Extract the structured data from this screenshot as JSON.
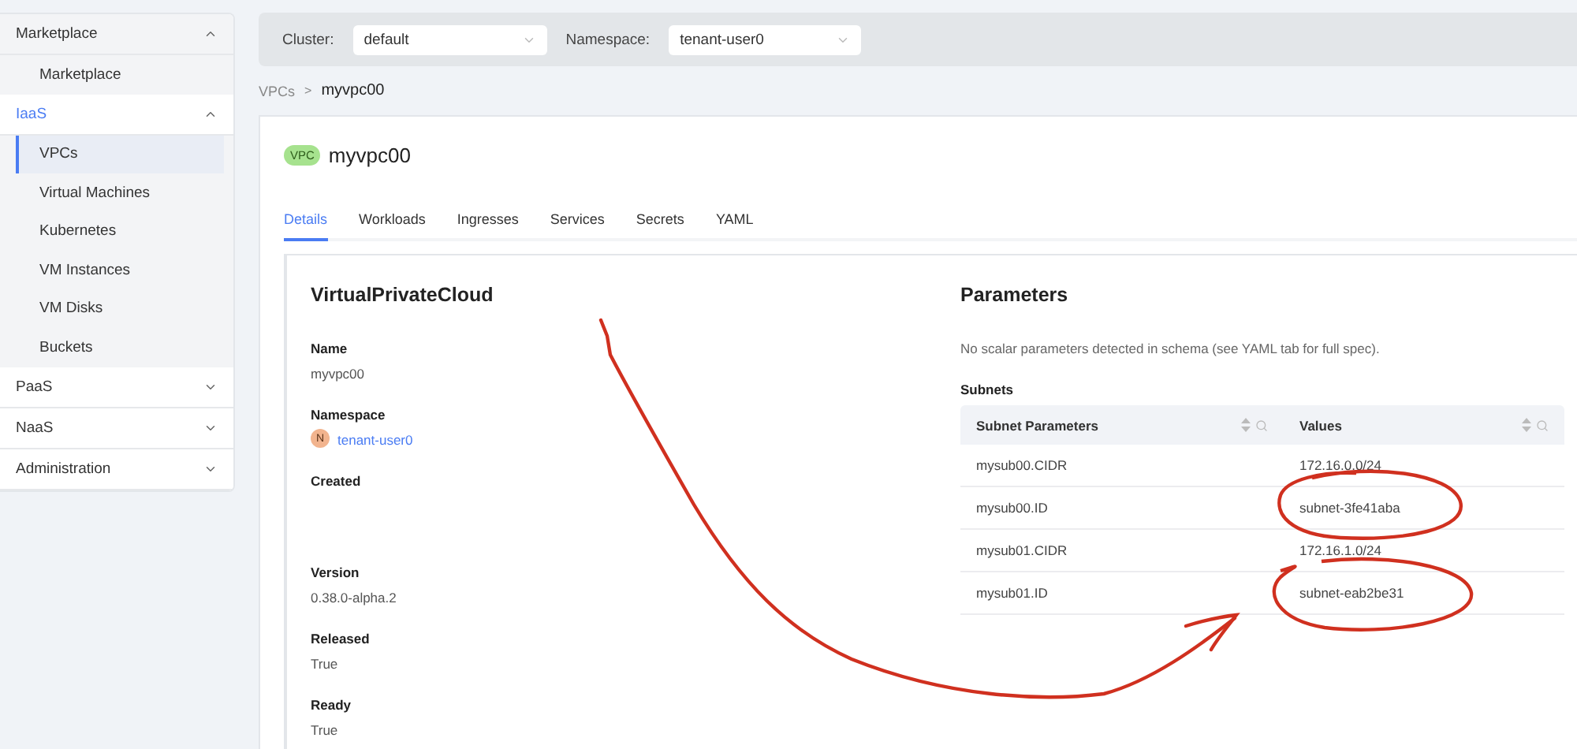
{
  "sidebar": {
    "groups": [
      {
        "label": "Marketplace",
        "expanded": true,
        "selected": false,
        "items": [
          {
            "label": "Marketplace",
            "selected": false
          }
        ]
      },
      {
        "label": "IaaS",
        "expanded": true,
        "selected": true,
        "items": [
          {
            "label": "VPCs",
            "selected": true
          },
          {
            "label": "Virtual Machines",
            "selected": false
          },
          {
            "label": "Kubernetes",
            "selected": false
          },
          {
            "label": "VM Instances",
            "selected": false
          },
          {
            "label": "VM Disks",
            "selected": false
          },
          {
            "label": "Buckets",
            "selected": false
          }
        ]
      },
      {
        "label": "PaaS",
        "expanded": false,
        "selected": false
      },
      {
        "label": "NaaS",
        "expanded": false,
        "selected": false
      },
      {
        "label": "Administration",
        "expanded": false,
        "selected": false
      }
    ]
  },
  "toolbar": {
    "cluster": {
      "label": "Cluster:",
      "value": "default"
    },
    "namespace": {
      "label": "Namespace:",
      "value": "tenant-user0"
    }
  },
  "breadcrumb": {
    "items": [
      "VPCs",
      "myvpc00"
    ],
    "separator": ">"
  },
  "header": {
    "badge": "VPC",
    "title": "myvpc00"
  },
  "tabs": [
    {
      "label": "Details",
      "selected": true
    },
    {
      "label": "Workloads",
      "selected": false
    },
    {
      "label": "Ingresses",
      "selected": false
    },
    {
      "label": "Services",
      "selected": false
    },
    {
      "label": "Secrets",
      "selected": false
    },
    {
      "label": "YAML",
      "selected": false
    }
  ],
  "details": {
    "title": "VirtualPrivateCloud",
    "fields": [
      {
        "kind": "text",
        "label": "Name",
        "value": "myvpc00"
      },
      {
        "kind": "namespace",
        "label": "Namespace",
        "avatar": "N",
        "value": "tenant-user0"
      },
      {
        "kind": "empty",
        "label": "Created"
      },
      {
        "kind": "text",
        "label": "Version",
        "value": "0.38.0-alpha.2"
      },
      {
        "kind": "text",
        "label": "Released",
        "value": "True"
      },
      {
        "kind": "text",
        "label": "Ready",
        "value": "True"
      }
    ]
  },
  "parameters": {
    "title": "Parameters",
    "note": "No scalar parameters detected in schema (see YAML tab for full spec).",
    "subnets_title": "Subnets",
    "table": {
      "columns": [
        "Subnet Parameters",
        "Values"
      ],
      "rows": [
        [
          "mysub00.CIDR",
          "172.16.0.0/24"
        ],
        [
          "mysub00.ID",
          "subnet-3fe41aba"
        ],
        [
          "mysub01.CIDR",
          "172.16.1.0/24"
        ],
        [
          "mysub01.ID",
          "subnet-eab2be31"
        ]
      ]
    }
  }
}
